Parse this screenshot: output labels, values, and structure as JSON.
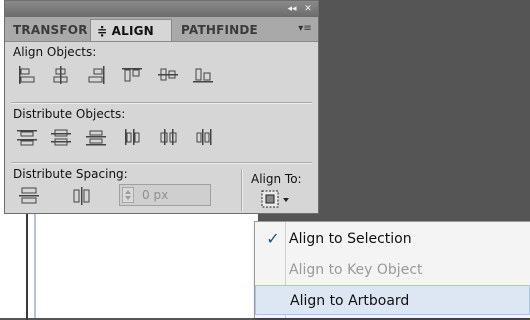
{
  "panel": {
    "topbar": {
      "collapse_icon": "double-chevron-left-icon",
      "close_icon": "close-icon",
      "collapse_label": "◂◂",
      "close_label": "✕"
    },
    "tabs": [
      {
        "label": "TRANSFOR",
        "active": false
      },
      {
        "label": "≑ ALIGN",
        "active": true
      },
      {
        "label": "PATHFINDE",
        "active": false
      }
    ],
    "tab_menu_label": "▾≡",
    "align_objects": {
      "label": "Align Objects:",
      "buttons": [
        "horizontal-align-left-icon",
        "horizontal-align-center-icon",
        "horizontal-align-right-icon",
        "vertical-align-top-icon",
        "vertical-align-center-icon",
        "vertical-align-bottom-icon"
      ]
    },
    "distribute_objects": {
      "label": "Distribute Objects:",
      "buttons": [
        "vertical-distribute-top-icon",
        "vertical-distribute-center-icon",
        "vertical-distribute-bottom-icon",
        "horizontal-distribute-left-icon",
        "horizontal-distribute-center-icon",
        "horizontal-distribute-right-icon"
      ]
    },
    "distribute_spacing": {
      "label": "Distribute Spacing:",
      "buttons": [
        "vertical-distribute-space-icon",
        "horizontal-distribute-space-icon"
      ],
      "value": "0 px"
    },
    "align_to": {
      "label": "Align To:",
      "icon": "align-to-selection-icon"
    }
  },
  "dropdown": {
    "items": [
      {
        "label": "Align to Selection",
        "checked": true,
        "enabled": true
      },
      {
        "label": "Align to Key Object",
        "checked": false,
        "enabled": false
      },
      {
        "label": "Align to Artboard",
        "checked": false,
        "enabled": true,
        "highlighted": true
      }
    ],
    "check_mark": "✓"
  },
  "colors": {
    "panel_bg": "#d6d6d6",
    "tab_bar_bg": "#a9a9a9",
    "menu_highlight": "#dde7f3",
    "check_color": "#1d4f93",
    "canvas_bg": "#555555"
  }
}
